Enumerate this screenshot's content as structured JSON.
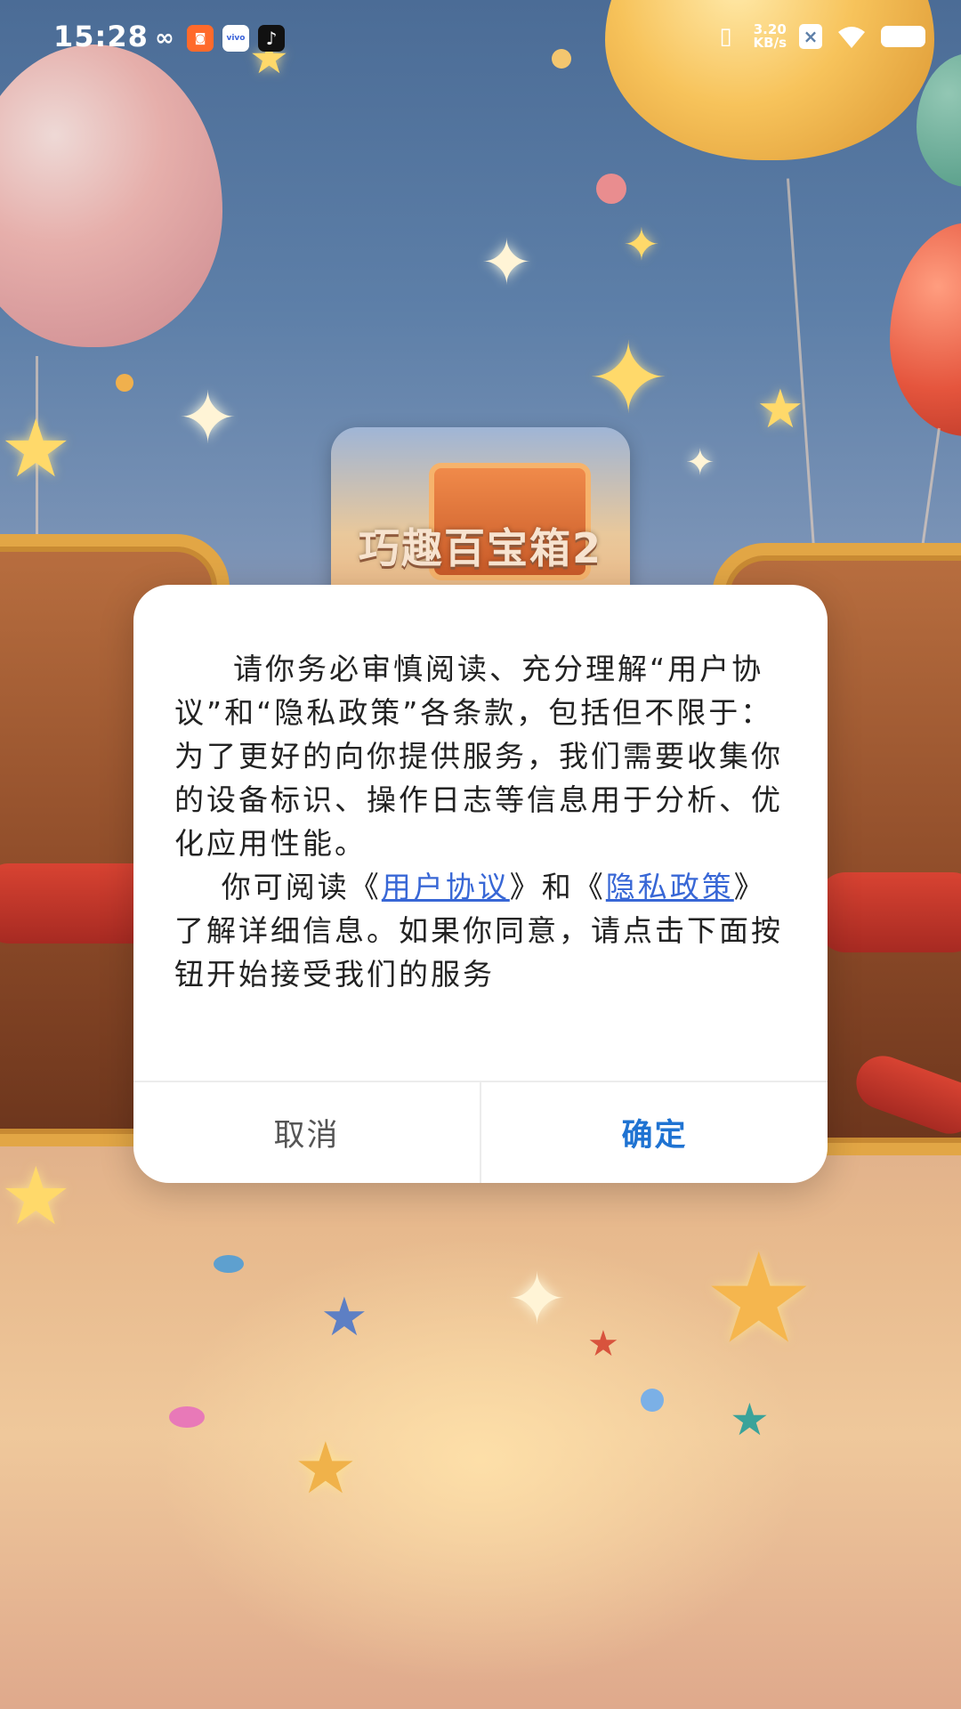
{
  "status_bar": {
    "time": "15:28",
    "app_icons": [
      "loop-app-icon",
      "orange-app-icon",
      "vivo-app-icon",
      "tiktok-icon"
    ],
    "vivo_label": "vivo",
    "net_speed_value": "3.20",
    "net_speed_unit": "KB/s",
    "system_icons": [
      "vibrate-icon",
      "no-sim-icon",
      "wifi-icon",
      "battery-icon"
    ]
  },
  "background": {
    "app_title": "巧趣百宝箱2"
  },
  "dialog": {
    "paragraph1": "请你务必审慎阅读、充分理解“用户协议”和“隐私政策”各条款，包括但不限于：为了更好的向你提供服务，我们需要收集你的设备标识、操作日志等信息用于分析、优化应用性能。",
    "p2_prefix": "你可阅读《",
    "user_agreement_link": "用户协议",
    "p2_middle": "》和《",
    "privacy_policy_link": "隐私政策",
    "p2_suffix": "》了解详细信息。如果你同意，请点击下面按钮开始接受我们的服务",
    "cancel_label": "取消",
    "confirm_label": "确定"
  },
  "colors": {
    "link": "#3867d6",
    "confirm": "#1f73d2",
    "cancel": "#555555"
  }
}
